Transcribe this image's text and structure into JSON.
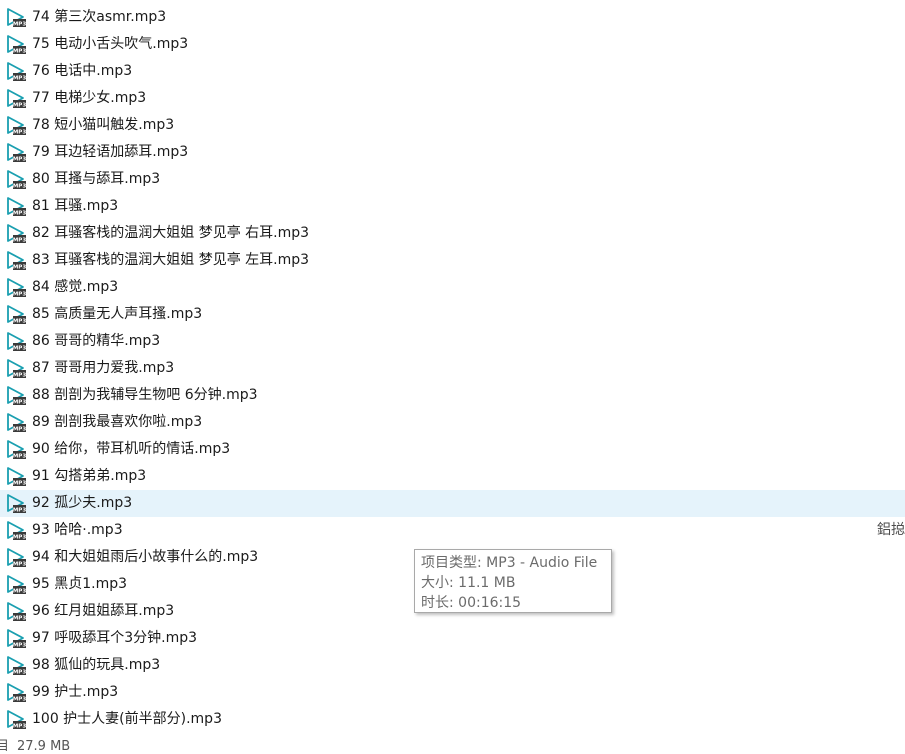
{
  "files": [
    {
      "name": "74  第三次asmr.mp3"
    },
    {
      "name": "75  电动小舌头吹气.mp3"
    },
    {
      "name": "76  电话中.mp3"
    },
    {
      "name": "77  电梯少女.mp3"
    },
    {
      "name": "78  短小猫叫触发.mp3"
    },
    {
      "name": "79  耳边轻语加舔耳.mp3"
    },
    {
      "name": "80  耳搔与舔耳.mp3"
    },
    {
      "name": "81  耳骚.mp3"
    },
    {
      "name": "82  耳骚客栈的温润大姐姐 梦见亭 右耳.mp3"
    },
    {
      "name": "83  耳骚客栈的温润大姐姐 梦见亭 左耳.mp3"
    },
    {
      "name": "84  感觉.mp3"
    },
    {
      "name": "85  高质量无人声耳搔.mp3"
    },
    {
      "name": "86  哥哥的精华.mp3"
    },
    {
      "name": "87  哥哥用力爱我.mp3"
    },
    {
      "name": "88  剖剖为我辅导生物吧   6分钟.mp3"
    },
    {
      "name": "89  剖剖我最喜欢你啦.mp3"
    },
    {
      "name": "90  给你，带耳机听的情话.mp3"
    },
    {
      "name": "91  勾搭弟弟.mp3"
    },
    {
      "name": "92  孤少夫.mp3",
      "selected": true
    },
    {
      "name": "93  哈哈·.mp3",
      "trail": "鋁搃"
    },
    {
      "name": "94  和大姐姐雨后小故事什么的.mp3"
    },
    {
      "name": "95  黑贞1.mp3"
    },
    {
      "name": "96  红月姐姐舔耳.mp3"
    },
    {
      "name": "97  呼吸舔耳个3分钟.mp3"
    },
    {
      "name": "98  狐仙的玩具.mp3"
    },
    {
      "name": "99  护士.mp3"
    },
    {
      "name": "100  护士人妻(前半部分).mp3"
    }
  ],
  "tooltip": {
    "type_line": "项目类型: MP3 - Audio File",
    "size_line": "大小: 11.1 MB",
    "duration_line": "时长: 00:16:15"
  },
  "status_bar": {
    "left_fragment": "目",
    "selected_size": "27.9 MB"
  },
  "colors": {
    "selected_row": "#e5f3fb",
    "icon_teal": "#1a9fb0"
  },
  "icon": "mp3-audio-file-icon"
}
